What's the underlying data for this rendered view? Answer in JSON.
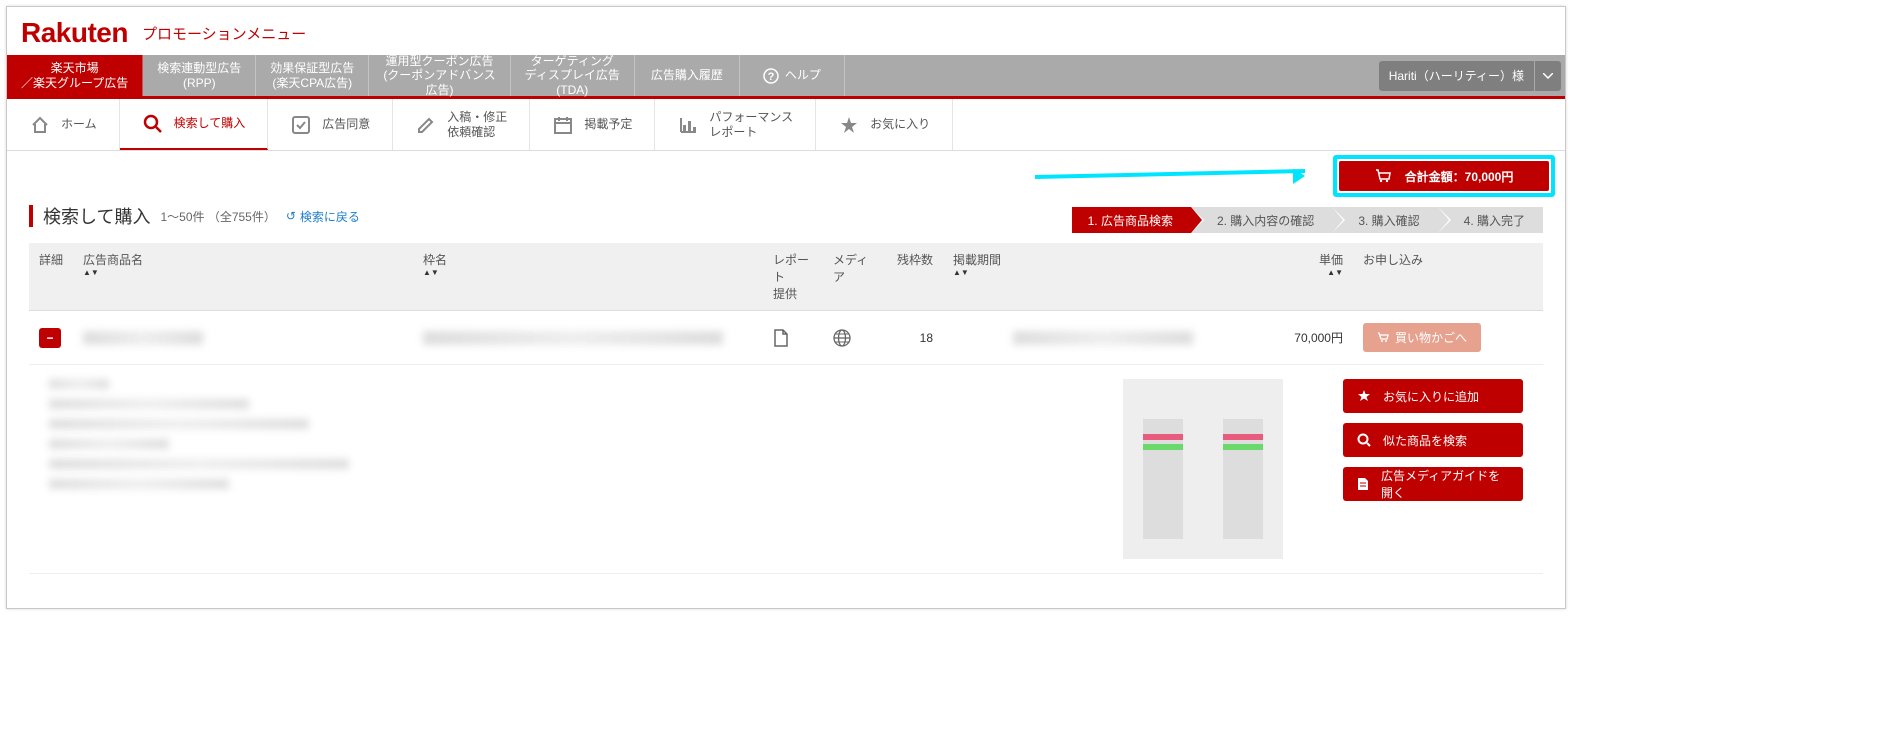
{
  "header": {
    "logo": "Rakuten",
    "page_title": "プロモーションメニュー"
  },
  "main_nav": {
    "items": [
      {
        "l1": "楽天市場",
        "l2": "／楽天グループ広告"
      },
      {
        "l1": "検索連動型広告",
        "l2": "(RPP)"
      },
      {
        "l1": "効果保証型広告",
        "l2": "(楽天CPA広告)"
      },
      {
        "l1": "運用型クーポン広告",
        "l2": "(クーポンアドバンス",
        "l3": "広告)"
      },
      {
        "l1": "ターゲティング",
        "l2": "ディスプレイ広告",
        "l3": "(TDA)"
      },
      {
        "l1": "広告購入履歴",
        "l2": ""
      }
    ],
    "help": "ヘルプ",
    "user": "Hariti（ハーリティー）様"
  },
  "sub_nav": {
    "items": [
      {
        "label": "ホーム"
      },
      {
        "label": "検索して購入"
      },
      {
        "label": "広告同意"
      },
      {
        "l1": "入稿・修正",
        "l2": "依頼確認"
      },
      {
        "label": "掲載予定"
      },
      {
        "l1": "パフォーマンス",
        "l2": "レポート"
      },
      {
        "label": "お気に入り"
      }
    ]
  },
  "cart": {
    "label": "合計金額：70,000円"
  },
  "title": {
    "text": "検索して購入",
    "count": "1～50件 （全755件）",
    "back": "検索に戻る"
  },
  "steps": [
    "1. 広告商品検索",
    "2. 購入内容の確認",
    "3. 購入確認",
    "4. 購入完了"
  ],
  "table": {
    "headers": {
      "detail": "詳細",
      "name": "広告商品名",
      "slot": "枠名",
      "report": "レポート",
      "report2": "提供",
      "media": "メディア",
      "remain": "残枠数",
      "period": "掲載期間",
      "price": "単価",
      "apply": "お申し込み"
    },
    "row": {
      "remain": "18",
      "price": "70,000円",
      "apply_label": "買い物かごへ"
    }
  },
  "detail_buttons": {
    "fav": "お気に入りに追加",
    "similar": "似た商品を検索",
    "guide": "広告メディアガイドを開く"
  }
}
